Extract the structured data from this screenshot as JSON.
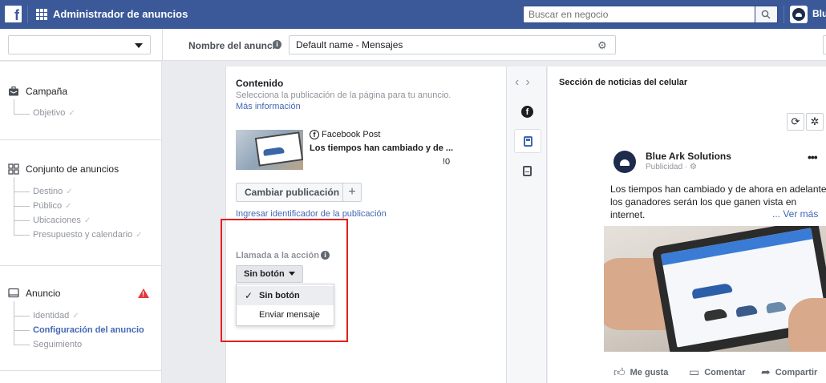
{
  "topbar": {
    "logo_letter": "f",
    "app_title": "Administrador de anuncios",
    "search_placeholder": "Buscar en negocio",
    "business_name": "Blu"
  },
  "subbar": {
    "ad_name_label": "Nombre del anuncio",
    "ad_name_value": "Default name - Mensajes"
  },
  "sidebar": {
    "campaign": {
      "label": "Campaña",
      "items": [
        {
          "label": "Objetivo",
          "check": "✓"
        }
      ]
    },
    "adset": {
      "label": "Conjunto de anuncios",
      "items": [
        {
          "label": "Destino",
          "check": "✓"
        },
        {
          "label": "Público",
          "check": "✓"
        },
        {
          "label": "Ubicaciones",
          "check": "✓"
        },
        {
          "label": "Presupuesto y calendario",
          "check": "✓"
        }
      ]
    },
    "ad": {
      "label": "Anuncio",
      "items": [
        {
          "label": "Identidad",
          "check": "✓"
        },
        {
          "label": "Configuración del anuncio",
          "check": ""
        },
        {
          "label": "Seguimiento",
          "check": ""
        }
      ]
    }
  },
  "editor": {
    "title": "Contenido",
    "description": "Selecciona la publicación de la página para tu anuncio.",
    "more_info_link": "Más información",
    "post_type": "Facebook Post",
    "post_title": "Los tiempos han cambiado y de ...",
    "post_date_fragment": "!0",
    "change_post_button": "Cambiar publicación",
    "add_button": "+",
    "post_id_link": "Ingresar identificador de la publicación",
    "cta_label": "Llamada a la acción",
    "cta_value": "Sin botón",
    "cta_options": [
      "Sin botón",
      "Enviar mensaje"
    ]
  },
  "preview": {
    "title": "Sección de noticias del celular",
    "page_name": "Blue Ark Solutions",
    "sponsored": "Publicidad · ",
    "post_text": "Los tiempos han cambiado y de ahora en adelante los ganadores serán los que ganen vista en internet.",
    "see_more": "... Ver más",
    "actions": [
      "Me gusta",
      "Comentar",
      "Compartir"
    ]
  },
  "colors": {
    "topbar": "#3b5998",
    "link": "#4267b2",
    "warning": "#e0393e",
    "highlight_box": "#e02020"
  }
}
